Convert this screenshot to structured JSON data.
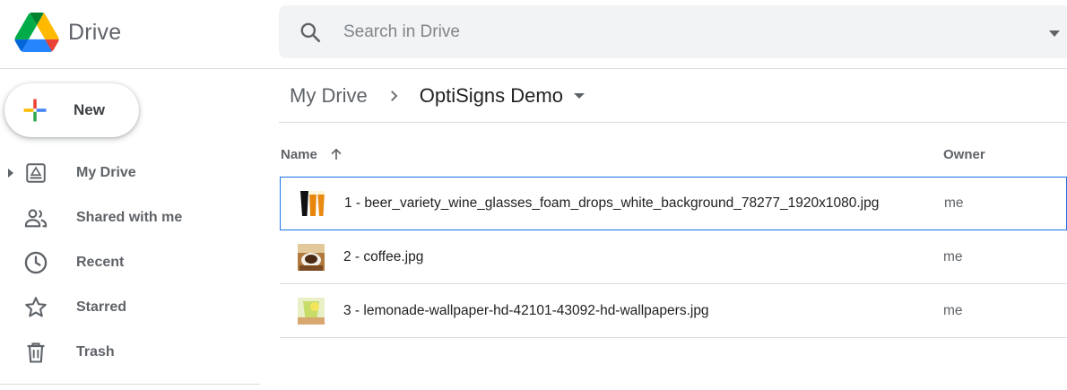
{
  "app": {
    "logo_text": "Drive"
  },
  "search": {
    "placeholder": "Search in Drive"
  },
  "sidebar": {
    "new_label": "New",
    "items": [
      {
        "label": "My Drive",
        "icon": "my-drive-icon"
      },
      {
        "label": "Shared with me",
        "icon": "shared-icon"
      },
      {
        "label": "Recent",
        "icon": "clock-icon"
      },
      {
        "label": "Starred",
        "icon": "star-icon"
      },
      {
        "label": "Trash",
        "icon": "trash-icon"
      }
    ]
  },
  "breadcrumb": {
    "root": "My Drive",
    "current": "OptiSigns Demo"
  },
  "columns": {
    "name": "Name",
    "owner": "Owner"
  },
  "files": [
    {
      "name": "1 - beer_variety_wine_glasses_foam_drops_white_background_78277_1920x1080.jpg",
      "owner": "me",
      "thumb": "beer-thumbnail"
    },
    {
      "name": "2 - coffee.jpg",
      "owner": "me",
      "thumb": "coffee-thumbnail"
    },
    {
      "name": "3 - lemonade-wallpaper-hd-42101-43092-hd-wallpapers.jpg",
      "owner": "me",
      "thumb": "lemonade-thumbnail"
    }
  ],
  "colors": {
    "accent": "#1a73e8",
    "text_secondary": "#5f6368",
    "search_bg": "#f1f3f4",
    "divider": "#dadce0"
  }
}
